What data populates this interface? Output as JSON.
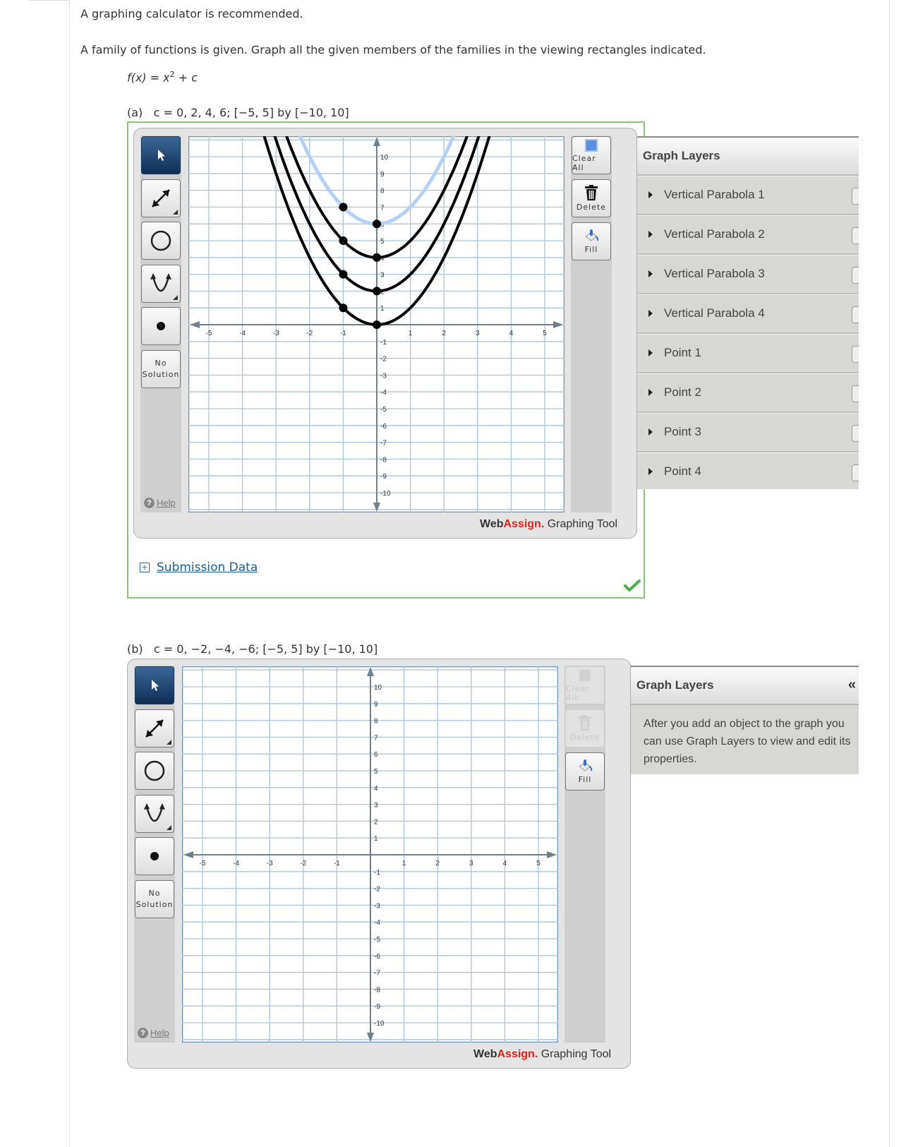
{
  "intro": "A graphing calculator is recommended.",
  "prompt": "A family of functions is given. Graph all the given members of the families in the viewing rectangles indicated.",
  "formula": {
    "lhs": "f(x)",
    "eq": " = ",
    "var": "x",
    "exp": "2",
    "rest": " + ",
    "c": "c"
  },
  "parts": [
    {
      "label": "(a)",
      "spec": "c = 0, 2, 4, 6; [−5, 5] by [−10, 10]",
      "status": "correct",
      "submission_link": "Submission Data",
      "layers_title": "Graph Layers",
      "layers": [
        "Vertical Parabola 1",
        "Vertical Parabola 2",
        "Vertical Parabola 3",
        "Vertical Parabola 4",
        "Point 1",
        "Point 2",
        "Point 3",
        "Point 4"
      ]
    },
    {
      "label": "(b)",
      "spec": "c = 0, −2, −4, −6; [−5, 5] by [−10, 10]",
      "layers_title": "Graph Layers",
      "collapse_icon": "«",
      "layers_empty": "After you add an object to the graph you can use Graph Layers to view and edit its properties."
    }
  ],
  "tools": {
    "no_solution_1": "No",
    "no_solution_2": "Solution",
    "help": "Help",
    "clear_all": "Clear All",
    "delete": "Delete",
    "fill": "Fill",
    "brand_web": "Web",
    "brand_assign": "Assign.",
    "brand_rest": " Graphing Tool"
  },
  "chart_data": [
    {
      "type": "line",
      "title": "(a) f(x) = x^2 + c",
      "xlim": [
        -5,
        5
      ],
      "ylim": [
        -10,
        10
      ],
      "grid": true,
      "x_ticks": [
        -5,
        -4,
        -3,
        -2,
        -1,
        1,
        2,
        3,
        4,
        5
      ],
      "y_ticks": [
        -10,
        -9,
        -8,
        -7,
        -6,
        -5,
        -4,
        -3,
        -2,
        -1,
        1,
        2,
        3,
        4,
        5,
        6,
        7,
        8,
        9,
        10
      ],
      "series": [
        {
          "name": "Vertical Parabola 1",
          "c": 0,
          "color": "#000000",
          "vertex": [
            0,
            0
          ],
          "point": [
            -1,
            1
          ]
        },
        {
          "name": "Vertical Parabola 2",
          "c": 2,
          "color": "#000000",
          "vertex": [
            0,
            2
          ],
          "point": [
            -1,
            3
          ]
        },
        {
          "name": "Vertical Parabola 3",
          "c": 4,
          "color": "#000000",
          "vertex": [
            0,
            4
          ],
          "point": [
            -1,
            5
          ]
        },
        {
          "name": "Vertical Parabola 4",
          "c": 6,
          "color": "#b5cff5",
          "vertex": [
            0,
            6
          ],
          "point": [
            -1,
            7
          ],
          "selected": true
        }
      ]
    },
    {
      "type": "line",
      "title": "(b) f(x) = x^2 + c",
      "xlim": [
        -5,
        5
      ],
      "ylim": [
        -10,
        10
      ],
      "grid": true,
      "x_ticks": [
        -5,
        -4,
        -3,
        -2,
        -1,
        1,
        2,
        3,
        4,
        5
      ],
      "y_ticks": [
        -10,
        -9,
        -8,
        -7,
        -6,
        -5,
        -4,
        -3,
        -2,
        -1,
        1,
        2,
        3,
        4,
        5,
        6,
        7,
        8,
        9,
        10
      ],
      "series": []
    }
  ]
}
